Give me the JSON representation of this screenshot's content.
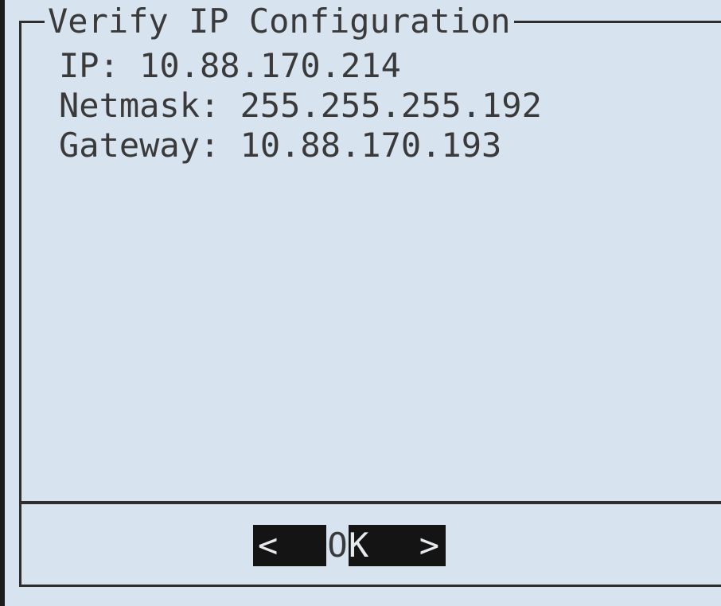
{
  "dialog": {
    "title": "Verify IP Configuration",
    "fields": [
      {
        "text": "IP: 10.88.170.214"
      },
      {
        "text": "Netmask: 255.255.255.192"
      },
      {
        "text": "Gateway: 10.88.170.193"
      }
    ]
  },
  "button": {
    "left_arrow": "<",
    "label_first": "O",
    "label_second": "K",
    "right_arrow": ">"
  },
  "colors": {
    "background": "#d7e3ee",
    "frame": "#2e2e2e",
    "text": "#3a3a3a",
    "button_bg": "#141414"
  }
}
